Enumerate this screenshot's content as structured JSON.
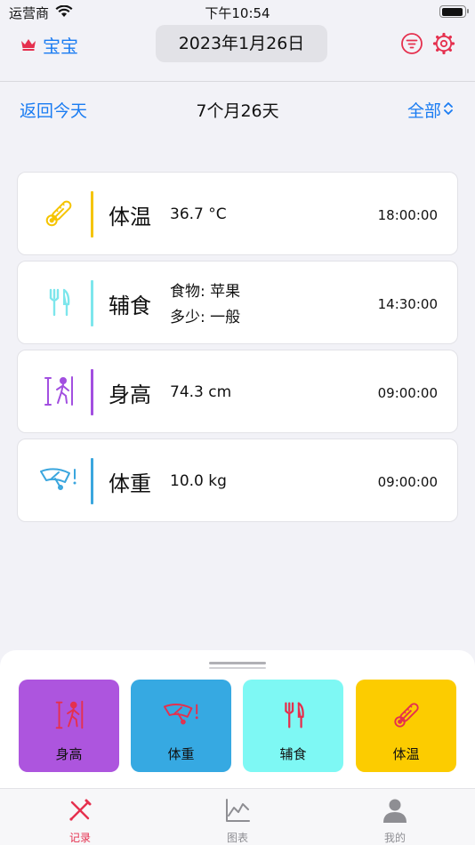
{
  "status_bar": {
    "carrier": "运营商",
    "time": "下午10:54"
  },
  "nav": {
    "baby_name": "宝宝",
    "date": "2023年1月26日"
  },
  "subbar": {
    "back_today": "返回今天",
    "age": "7个月26天",
    "filter": "全部"
  },
  "records": [
    {
      "title": "体温",
      "value": "36.7 °C",
      "time": "18:00:00",
      "icon": "thermometer-icon",
      "color": "#f5c400"
    },
    {
      "title": "辅食",
      "details": [
        "食物: 苹果",
        "多少: 一般"
      ],
      "time": "14:30:00",
      "icon": "fork-knife-icon",
      "color": "#7de6ec"
    },
    {
      "title": "身高",
      "value": "74.3 cm",
      "time": "09:00:00",
      "icon": "height-icon",
      "color": "#a24fe0"
    },
    {
      "title": "体重",
      "value": "10.0 kg",
      "time": "09:00:00",
      "icon": "scale-icon",
      "color": "#3aa6de"
    }
  ],
  "quick_add": [
    {
      "label": "身高",
      "icon": "height-icon",
      "color": "#ad55de"
    },
    {
      "label": "体重",
      "icon": "scale-icon",
      "color": "#36a9e2"
    },
    {
      "label": "辅食",
      "icon": "fork-knife-icon",
      "color": "#7ef8f4"
    },
    {
      "label": "体温",
      "icon": "thermometer-icon",
      "color": "#fccc00"
    }
  ],
  "tabs": [
    {
      "label": "记录",
      "icon": "pencil-ruler-icon",
      "active": true
    },
    {
      "label": "图表",
      "icon": "chart-icon",
      "active": false
    },
    {
      "label": "我的",
      "icon": "person-icon",
      "active": false
    }
  ],
  "colors": {
    "accent": "#1a7cf2",
    "active_tab": "#e5304e",
    "icon_red": "#e5304e",
    "inactive": "#8e8e93"
  }
}
